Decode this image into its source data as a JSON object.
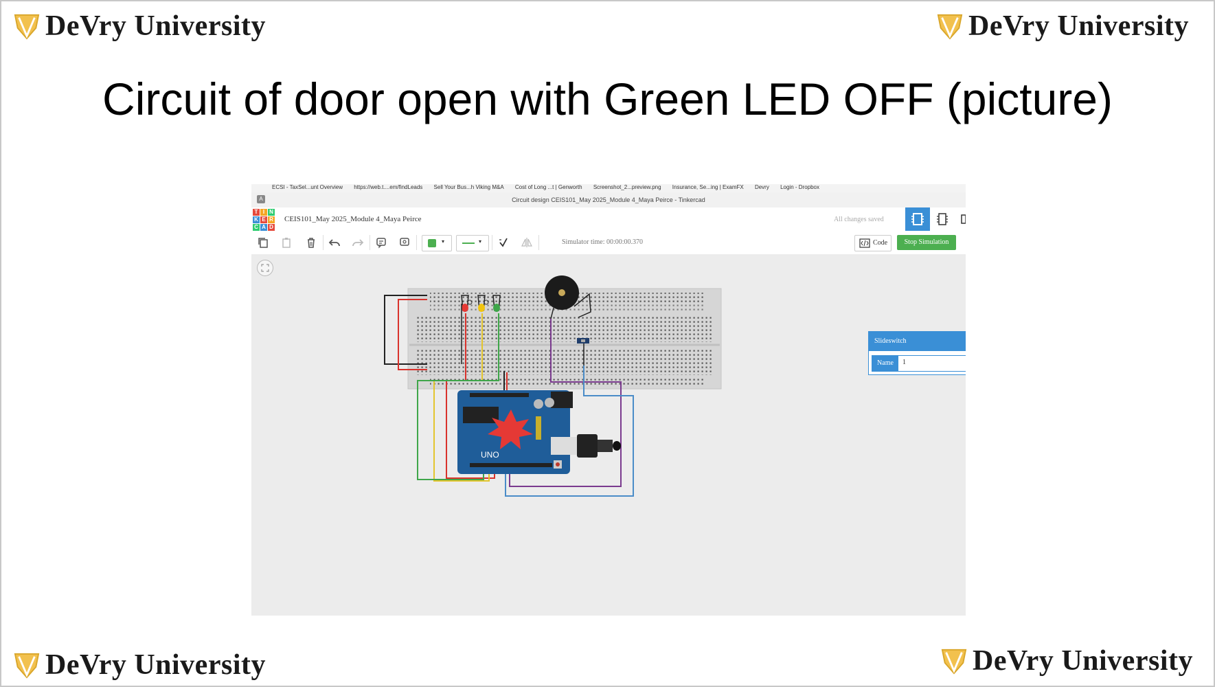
{
  "slide": {
    "brand": "DeVry University",
    "title": "Circuit of door open with Green LED OFF (picture)"
  },
  "browser": {
    "bookmarks": [
      "ECSI - TaxSel...unt Overview",
      "https://web.t....em/findLeads",
      "Sell Your Bus...h Viking M&A",
      "Cost of Long ...t | Genworth",
      "Screenshot_2...preview.png",
      "Insurance, Se...ing | ExamFX",
      "Devry",
      "Login - Dropbox"
    ],
    "window_title": "Circuit design CEIS101_May 2025_Module 4_Maya Peirce - Tinkercad",
    "profile_letter": "A"
  },
  "app": {
    "logo_letters": [
      "T",
      "I",
      "N",
      "K",
      "E",
      "R",
      "C",
      "A",
      "D"
    ],
    "logo_colors": [
      "#e64a3c",
      "#f5a623",
      "#2ecc71",
      "#3a8fd6",
      "#e64a3c",
      "#f5a623",
      "#2ecc71",
      "#3a8fd6",
      "#e64a3c"
    ],
    "project_name": "CEIS101_May 2025_Module 4_Maya Peirce",
    "save_status": "All changes saved"
  },
  "toolbar": {
    "simulator_time": "Simulator time: 00:00:00.370",
    "code_label": "Code",
    "stop_label": "Stop Simulation",
    "color_swatch": "#4caf50"
  },
  "inspector": {
    "component": "Slideswitch",
    "name_label": "Name",
    "name_value": "1"
  },
  "colors": {
    "accent": "#3a8fd6",
    "stop": "#4caf50",
    "board": "#1f5d99",
    "wire_red": "#d9322c",
    "wire_yellow": "#e3c52d",
    "wire_green": "#3fa64a",
    "wire_purple": "#7a3a8e",
    "wire_blue": "#4a8cc8",
    "wire_black": "#222222"
  }
}
